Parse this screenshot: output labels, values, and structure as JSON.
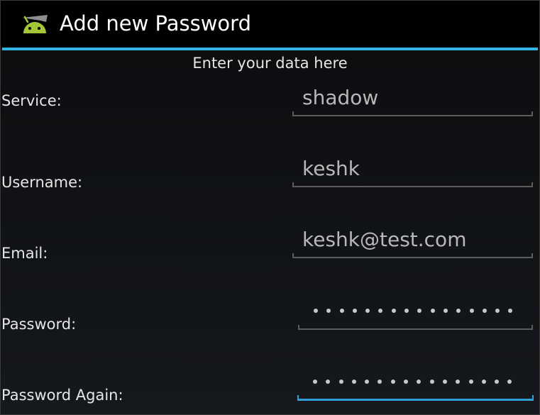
{
  "action_bar": {
    "title": "Add new Password",
    "icon": "android-app-icon",
    "accent_color": "#33b5e5"
  },
  "form": {
    "subtitle": "Enter your data here",
    "service": {
      "label": "Service:",
      "value": "shadow"
    },
    "username": {
      "label": "Username:",
      "value": "keshk"
    },
    "email": {
      "label": "Email:",
      "value": "keshk@test.com"
    },
    "password": {
      "label": "Password:",
      "masked_length": 16
    },
    "password_again": {
      "label": "Password Again:",
      "masked_length": 16,
      "focused": true
    }
  }
}
